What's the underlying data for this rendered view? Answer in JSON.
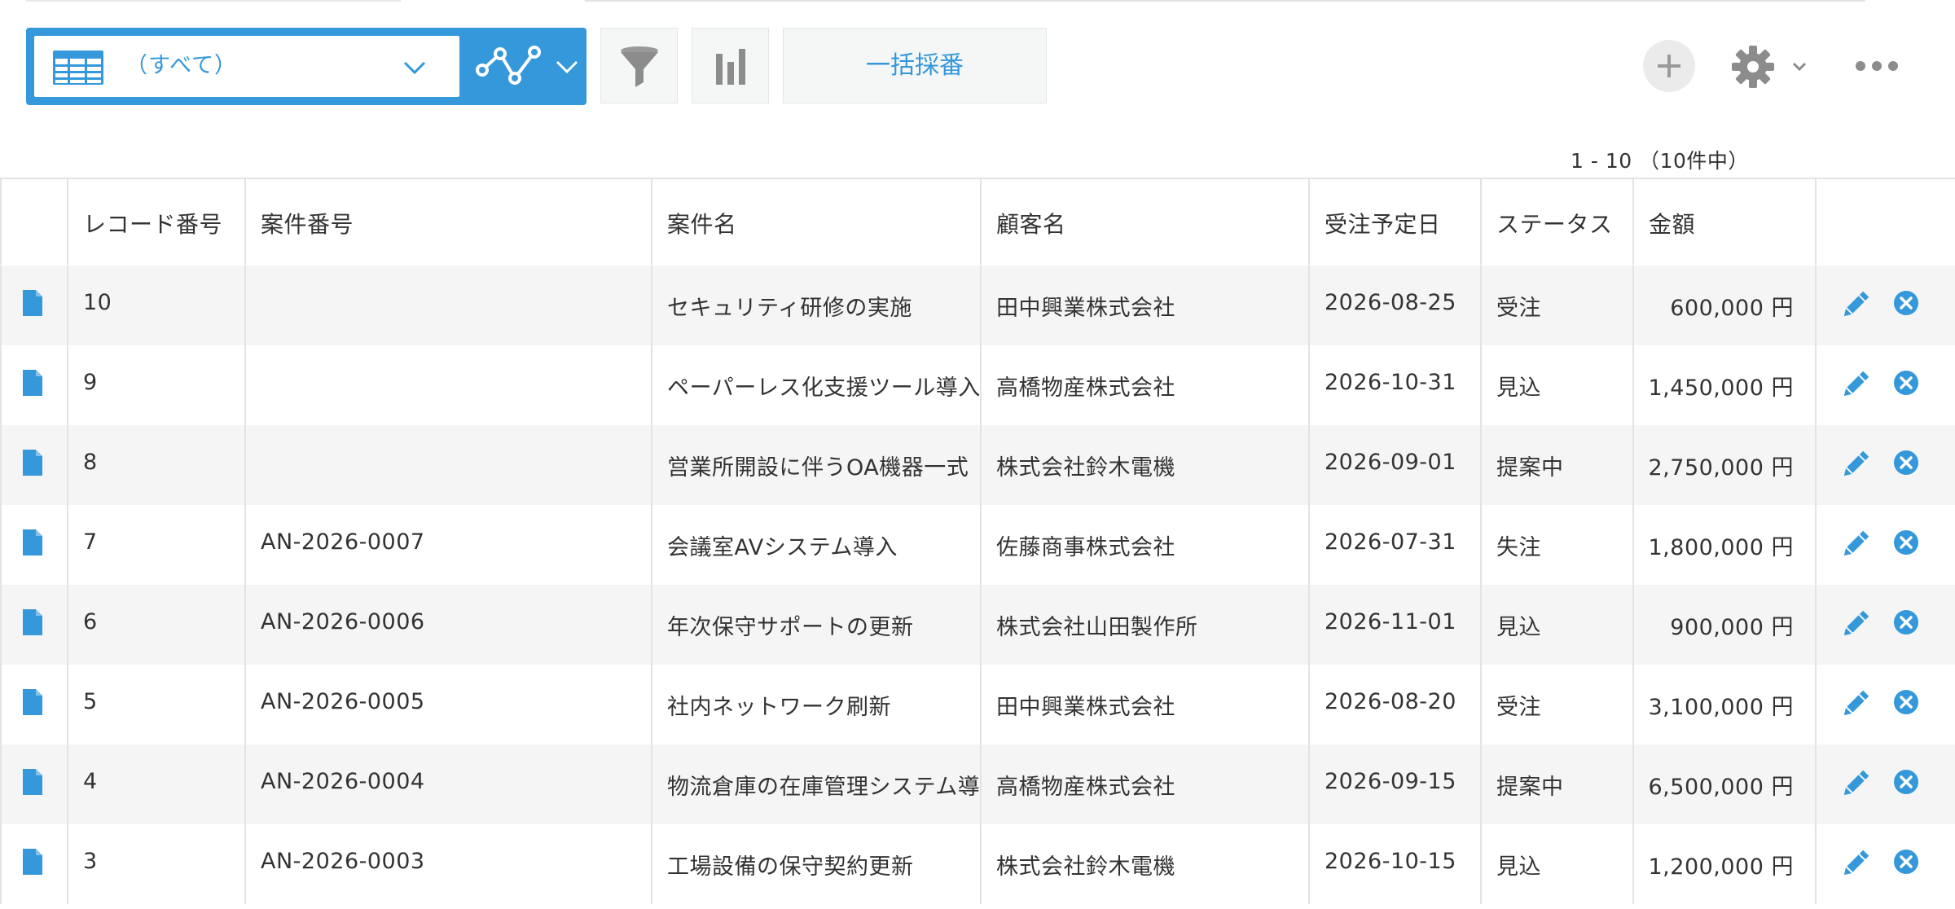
{
  "toolbar": {
    "view_label": "（すべて）",
    "bulk_number_label": "一括採番"
  },
  "pager": {
    "text": "1 - 10 （10件中）"
  },
  "table": {
    "columns": [
      "レコード番号",
      "案件番号",
      "案件名",
      "顧客名",
      "受注予定日",
      "ステータス",
      "金額"
    ],
    "rows": [
      {
        "record_no": "10",
        "case_no": "",
        "case_name": "セキュリティ研修の実施",
        "customer": "田中興業株式会社",
        "date": "2026-08-25",
        "status": "受注",
        "amount": "600,000 円"
      },
      {
        "record_no": "9",
        "case_no": "",
        "case_name": "ペーパーレス化支援ツール導入",
        "customer": "高橋物産株式会社",
        "date": "2026-10-31",
        "status": "見込",
        "amount": "1,450,000 円"
      },
      {
        "record_no": "8",
        "case_no": "",
        "case_name": "営業所開設に伴うOA機器一式",
        "customer": "株式会社鈴木電機",
        "date": "2026-09-01",
        "status": "提案中",
        "amount": "2,750,000 円"
      },
      {
        "record_no": "7",
        "case_no": "AN-2026-0007",
        "case_name": "会議室AVシステム導入",
        "customer": "佐藤商事株式会社",
        "date": "2026-07-31",
        "status": "失注",
        "amount": "1,800,000 円"
      },
      {
        "record_no": "6",
        "case_no": "AN-2026-0006",
        "case_name": "年次保守サポートの更新",
        "customer": "株式会社山田製作所",
        "date": "2026-11-01",
        "status": "見込",
        "amount": "900,000 円"
      },
      {
        "record_no": "5",
        "case_no": "AN-2026-0005",
        "case_name": "社内ネットワーク刷新",
        "customer": "田中興業株式会社",
        "date": "2026-08-20",
        "status": "受注",
        "amount": "3,100,000 円"
      },
      {
        "record_no": "4",
        "case_no": "AN-2026-0004",
        "case_name": "物流倉庫の在庫管理システム導入",
        "customer": "高橋物産株式会社",
        "date": "2026-09-15",
        "status": "提案中",
        "amount": "6,500,000 円"
      },
      {
        "record_no": "3",
        "case_no": "AN-2026-0003",
        "case_name": "工場設備の保守契約更新",
        "customer": "株式会社鈴木電機",
        "date": "2026-10-15",
        "status": "見込",
        "amount": "1,200,000 円"
      }
    ]
  },
  "colors": {
    "accent": "#3498db",
    "row_alt": "#f5f5f5",
    "border": "#e3e3e3",
    "icon_gray": "#8c8c8c"
  },
  "icons": {
    "view": "table-icon",
    "graph": "graph-icon",
    "filter": "filter-icon",
    "chart": "bar-chart-icon",
    "add": "plus-icon",
    "settings": "gear-icon",
    "more": "more-icon",
    "record": "document-icon",
    "edit": "pencil-icon",
    "delete": "delete-icon"
  }
}
